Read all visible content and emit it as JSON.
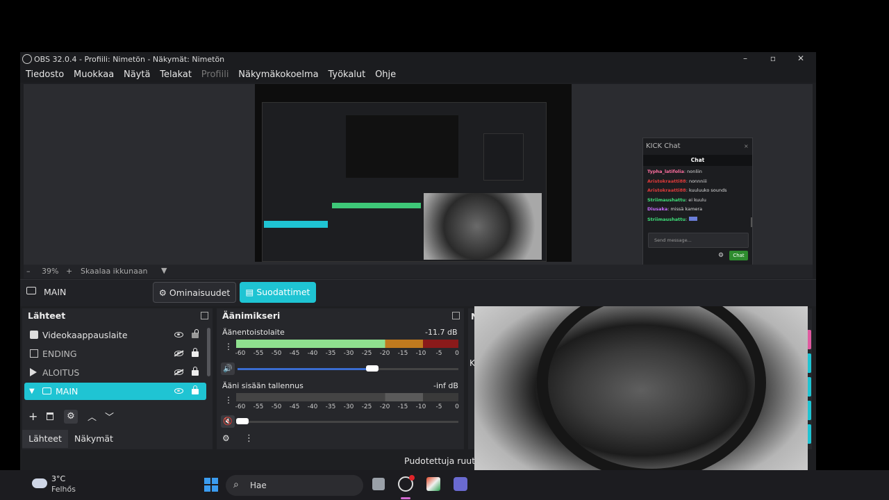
{
  "window": {
    "title": "OBS 32.0.4 - Profiili: Nimetön - Näkymät: Nimetön",
    "controls": {
      "minimize": "–",
      "maximize": "▫",
      "close": "✕"
    }
  },
  "menu": {
    "items": [
      "Tiedosto",
      "Muokkaa",
      "Näytä",
      "Telakat",
      "Profiili",
      "Näkymäkokoelma",
      "Työkalut",
      "Ohje"
    ]
  },
  "zoom": {
    "minus": "–",
    "percent": "39%",
    "plus": "+",
    "mode": "Skaalaa ikkunaan"
  },
  "context": {
    "scene_name": "MAIN",
    "properties_label": "Ominaisuudet",
    "filters_label": "Suodattimet",
    "accent": "#1fc4d3"
  },
  "sources": {
    "header": "Lähteet",
    "items": [
      {
        "name": "Videokaappauslaite",
        "icon": "camera-icon",
        "visible": true,
        "locked": false
      },
      {
        "name": "ENDING",
        "icon": "image-icon",
        "visible": false,
        "locked": true
      },
      {
        "name": "ALOITUS",
        "icon": "play-icon",
        "visible": false,
        "locked": true
      },
      {
        "name": "MAIN",
        "icon": "folder-icon",
        "visible": true,
        "locked": true,
        "selected": true
      }
    ],
    "tabs": [
      "Lähteet",
      "Näkymät"
    ]
  },
  "mixer": {
    "header": "Äänimikseri",
    "channels": [
      {
        "name": "Äänentoistolaite",
        "db": "-11.7 dB"
      },
      {
        "name": "Ääni sisään tallennus",
        "db": "-inf dB"
      }
    ],
    "scale": [
      "-60",
      "-55",
      "-50",
      "-45",
      "-40",
      "-35",
      "-30",
      "-25",
      "-20",
      "-15",
      "-10",
      "-5",
      "0"
    ]
  },
  "third_panel": {
    "header_fragment": "N",
    "text_fragment": "K"
  },
  "status": {
    "dropped_frames": "Pudotettuja ruutuja"
  },
  "kick_chat": {
    "window_title": "KICK Chat",
    "header": "Chat",
    "messages": [
      {
        "user": "Typha_latifolia",
        "text": ": nonliin",
        "color": "#ff6fa0"
      },
      {
        "user": "Aristokraatti88",
        "text": ": nonnniii",
        "color": "#e23b3b"
      },
      {
        "user": "Aristokraatti88",
        "text": ": kuuluuko sounds",
        "color": "#e23b3b"
      },
      {
        "user": "Striimaushattu",
        "text": ": ei kuulu",
        "color": "#3fe07a"
      },
      {
        "user": "Diusaka",
        "text": ": missä kamera",
        "color": "#c86bff"
      },
      {
        "user": "Striimaushattu",
        "text": ":",
        "color": "#3fe07a"
      }
    ],
    "input_placeholder": "Send message...",
    "send_label": "Chat"
  },
  "taskbar": {
    "temperature": "3°C",
    "weather": "Felhős",
    "search_label": "Hae"
  }
}
